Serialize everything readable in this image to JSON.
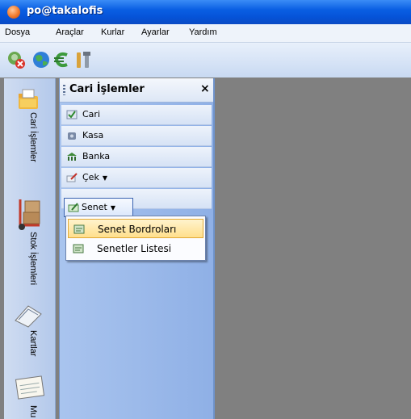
{
  "window": {
    "title": "po@takalofis"
  },
  "menu": [
    "Dosya",
    "Araçlar",
    "Kurlar",
    "Ayarlar",
    "Yardım"
  ],
  "toolbar": {
    "icons": [
      "exit-icon",
      "globe-icon",
      "currency-icon",
      "tools-icon"
    ]
  },
  "leftbar": {
    "tabs": [
      {
        "label": "Cari İşlemler",
        "icon": "folder-icon"
      },
      {
        "label": "Stok İşlemleri",
        "icon": "hand-truck-icon"
      },
      {
        "label": "Kartlar",
        "icon": "clipboard-icon"
      },
      {
        "label": "Mu",
        "icon": "accounts-book-icon"
      }
    ]
  },
  "panel": {
    "title": "Cari İşlemler",
    "close": "×",
    "items": [
      {
        "label": "Cari",
        "icon": "checklist-icon"
      },
      {
        "label": "Kasa",
        "icon": "safe-icon"
      },
      {
        "label": "Banka",
        "icon": "bank-icon"
      },
      {
        "label": "Çek",
        "icon": "check-pen-icon",
        "has_dropdown": true
      },
      {
        "label": "Senet",
        "icon": "note-icon",
        "has_dropdown": true
      }
    ],
    "dropdown_arrow": "▼"
  },
  "dropdown": {
    "items": [
      {
        "label": "Senet Bordroları",
        "highlighted": true
      },
      {
        "label": "Senetler Listesi",
        "highlighted": false
      }
    ]
  }
}
